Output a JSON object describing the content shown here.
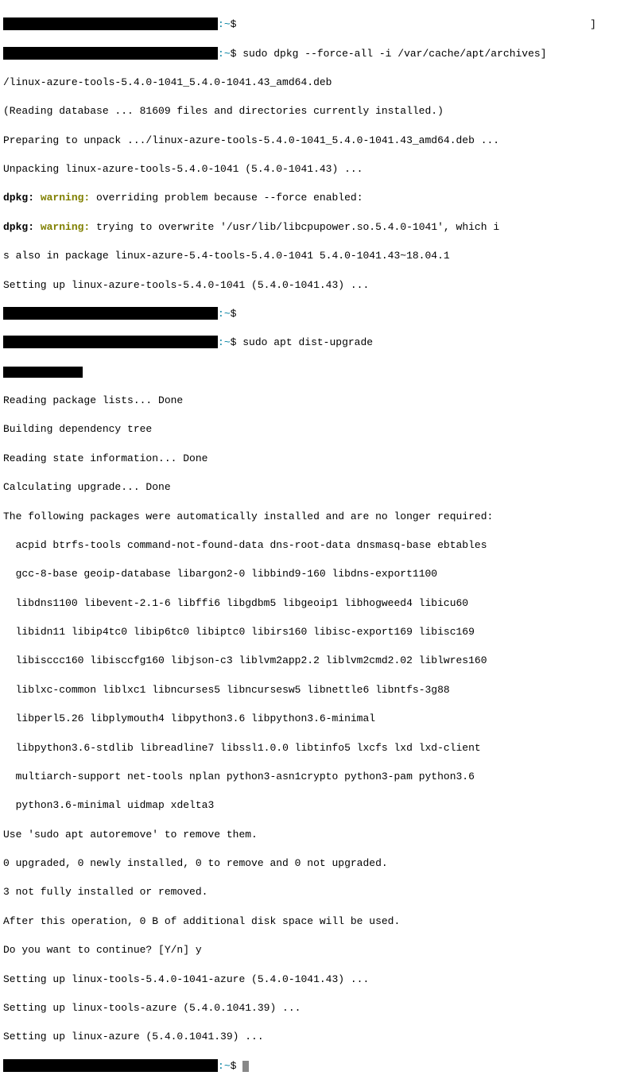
{
  "prompt": {
    "path": "~",
    "dollar": "$"
  },
  "commands": {
    "cmd1": "sudo dpkg --force-all -i /var/cache/apt/archives",
    "cmd1_line2": "/linux-azure-tools-5.4.0-1041_5.4.0-1041.43_amd64.deb",
    "cmd2": "sudo apt dist-upgrade"
  },
  "dpkg_output": {
    "reading_db": "(Reading database ... 81609 files and directories currently installed.)",
    "preparing": "Preparing to unpack .../linux-azure-tools-5.4.0-1041_5.4.0-1041.43_amd64.deb ...",
    "unpacking": "Unpacking linux-azure-tools-5.4.0-1041 (5.4.0-1041.43) ...",
    "dpkg_label": "dpkg:",
    "warning_label": "warning:",
    "warn1": " overriding problem because --force enabled:",
    "warn2": " trying to overwrite '/usr/lib/libcpupower.so.5.4.0-1041', which i",
    "warn2_cont": "s also in package linux-azure-5.4-tools-5.4.0-1041 5.4.0-1041.43~18.04.1",
    "setting_up": "Setting up linux-azure-tools-5.4.0-1041 (5.4.0-1041.43) ..."
  },
  "apt_output": {
    "empty": " ",
    "reading_lists": "Reading package lists... Done",
    "building_tree": "Building dependency tree",
    "reading_state": "Reading state information... Done",
    "calculating": "Calculating upgrade... Done",
    "auto_installed": "The following packages were automatically installed and are no longer required:",
    "pkg1": "  acpid btrfs-tools command-not-found-data dns-root-data dnsmasq-base ebtables",
    "pkg2": "  gcc-8-base geoip-database libargon2-0 libbind9-160 libdns-export1100",
    "pkg3": "  libdns1100 libevent-2.1-6 libffi6 libgdbm5 libgeoip1 libhogweed4 libicu60",
    "pkg4": "  libidn11 libip4tc0 libip6tc0 libiptc0 libirs160 libisc-export169 libisc169",
    "pkg5": "  libisccc160 libisccfg160 libjson-c3 liblvm2app2.2 liblvm2cmd2.02 liblwres160",
    "pkg6": "  liblxc-common liblxc1 libncurses5 libncursesw5 libnettle6 libntfs-3g88",
    "pkg7": "  libperl5.26 libplymouth4 libpython3.6 libpython3.6-minimal",
    "pkg8": "  libpython3.6-stdlib libreadline7 libssl1.0.0 libtinfo5 lxcfs lxd lxd-client",
    "pkg9": "  multiarch-support net-tools nplan python3-asn1crypto python3-pam python3.6",
    "pkg10": "  python3.6-minimal uidmap xdelta3",
    "autoremove": "Use 'sudo apt autoremove' to remove them.",
    "upgrade_summary": "0 upgraded, 0 newly installed, 0 to remove and 0 not upgraded.",
    "not_fully": "3 not fully installed or removed.",
    "after_op": "After this operation, 0 B of additional disk space will be used.",
    "continue_prompt": "Do you want to continue? [Y/n] y",
    "setup1": "Setting up linux-tools-5.4.0-1041-azure (5.4.0-1041.43) ...",
    "setup2": "Setting up linux-tools-azure (5.4.0.1041.39) ...",
    "setup3": "Setting up linux-azure (5.4.0.1041.39) ..."
  },
  "bracket": "]"
}
